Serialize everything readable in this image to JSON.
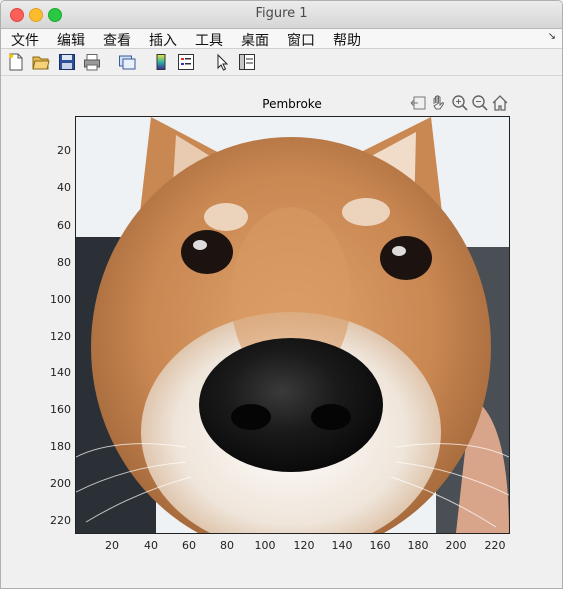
{
  "window": {
    "title": "Figure 1"
  },
  "menu": {
    "items": [
      "文件",
      "编辑",
      "查看",
      "插入",
      "工具",
      "桌面",
      "窗口",
      "帮助"
    ]
  },
  "toolbar": {
    "icons": [
      "new-figure-icon",
      "open-file-icon",
      "save-icon",
      "print-icon",
      "link-plot-icon",
      "colorbar-icon",
      "legend-icon",
      "edit-plot-arrow-icon",
      "property-inspector-icon"
    ]
  },
  "axes_toolbar": {
    "icons": [
      "export-icon",
      "pan-hand-icon",
      "zoom-in-icon",
      "zoom-out-icon",
      "home-icon"
    ]
  },
  "axes": {
    "title": "Pembroke",
    "ytick_labels": [
      "20",
      "40",
      "60",
      "80",
      "100",
      "120",
      "140",
      "160",
      "180",
      "200",
      "220"
    ],
    "xtick_labels": [
      "20",
      "40",
      "60",
      "80",
      "100",
      "120",
      "140",
      "160",
      "180",
      "200",
      "220"
    ]
  },
  "image": {
    "subject": "dog-face-closeup"
  },
  "colors": {
    "fur": "#c98752",
    "fur_light": "#f2e6da",
    "nose": "#141414",
    "background": "#f0f0f0"
  }
}
